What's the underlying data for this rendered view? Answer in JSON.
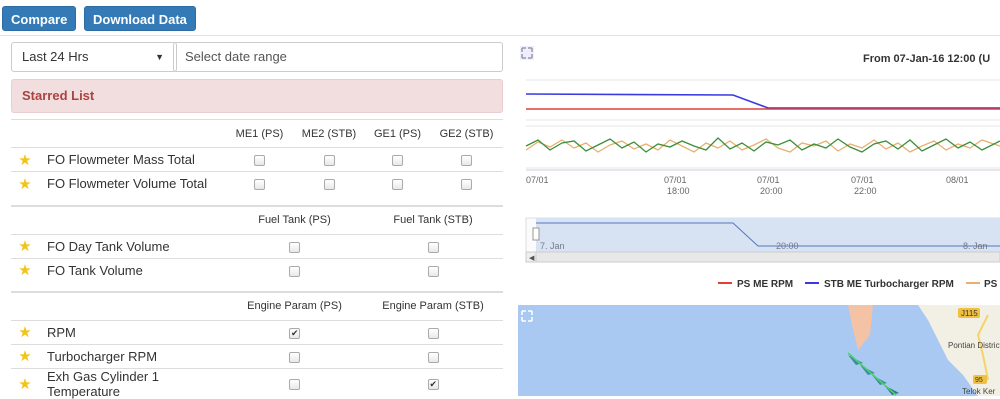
{
  "toolbar": {
    "compare": "Compare",
    "download": "Download Data"
  },
  "filters": {
    "period": "Last 24 Hrs",
    "date_placeholder": "Select date range"
  },
  "starred_title": "Starred List",
  "group1": {
    "headers": [
      "ME1 (PS)",
      "ME2 (STB)",
      "GE1 (PS)",
      "GE2 (STB)"
    ],
    "rows": [
      {
        "label": "FO Flowmeter Mass Total",
        "checks": [
          false,
          false,
          false,
          false
        ]
      },
      {
        "label": "FO Flowmeter Volume Total",
        "checks": [
          false,
          false,
          false,
          false
        ]
      }
    ]
  },
  "group2": {
    "headers": [
      "Fuel Tank (PS)",
      "Fuel Tank (STB)"
    ],
    "rows": [
      {
        "label": "FO Day Tank Volume",
        "checks": [
          false,
          false
        ]
      },
      {
        "label": "FO Tank Volume",
        "checks": [
          false,
          false
        ]
      }
    ]
  },
  "group3": {
    "headers": [
      "Engine Param (PS)",
      "Engine Param (STB)"
    ],
    "rows": [
      {
        "label": "RPM",
        "checks": [
          true,
          false
        ]
      },
      {
        "label": "Turbocharger RPM",
        "checks": [
          false,
          false
        ]
      },
      {
        "label": "Exh Gas Cylinder 1 Temperature",
        "checks": [
          false,
          true
        ]
      }
    ]
  },
  "chart": {
    "title": "From 07-Jan-16 12:00 (U",
    "x_ticks": [
      {
        "l1": "07/01",
        "l2": ""
      },
      {
        "l1": "07/01",
        "l2": "18:00"
      },
      {
        "l1": "07/01",
        "l2": "20:00"
      },
      {
        "l1": "07/01",
        "l2": "22:00"
      },
      {
        "l1": "08/01",
        "l2": ""
      }
    ],
    "navigator_labels": [
      "7. Jan",
      "20:00",
      "8. Jan"
    ],
    "legend": [
      {
        "name": "PS ME RPM",
        "color": "#e0403a"
      },
      {
        "name": "STB ME Turbocharger RPM",
        "color": "#3a3ae0"
      },
      {
        "name": "PS (",
        "color": "#e8b070"
      }
    ]
  },
  "map": {
    "labels": [
      "J115",
      "Pontian District",
      "95",
      "Telok Ker"
    ]
  },
  "colors": {
    "primary": "#337ab7",
    "danger_bg": "#f2dede",
    "danger_text": "#a94442",
    "star": "#f0c419"
  }
}
